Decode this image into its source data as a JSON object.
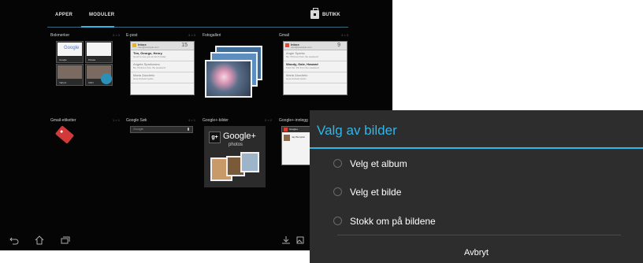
{
  "launcher": {
    "tabs": [
      {
        "label": "APPER"
      },
      {
        "label": "MODULER"
      }
    ],
    "store_label": "BUTIKK",
    "widgets": [
      {
        "label": "Bokmerker",
        "size": "3 × 3"
      },
      {
        "label": "E-post",
        "size": "3 × 3"
      },
      {
        "label": "Fotogalleri",
        "size": ""
      },
      {
        "label": "Gmail",
        "size": "3 × 3"
      },
      {
        "label": "Gmail-etiketter",
        "size": "1 × 1"
      },
      {
        "label": "Google Søk",
        "size": "4 × 1"
      },
      {
        "label": "Google+-bilder",
        "size": "2 × 2"
      },
      {
        "label": "Google+-innlegg",
        "size": "3 × 2"
      }
    ],
    "bookmarks": {
      "google_text": "Google",
      "captions": [
        "Google",
        "Picasa",
        "Yahoo!",
        "CNN"
      ]
    },
    "email": {
      "title": "Inbox",
      "subtitle": "user@example.com",
      "count": "15",
      "items": [
        {
          "name": "Tim, George, Henry",
          "preview": "Good to see you at lunch today"
        },
        {
          "name": "Angela Sparkowna",
          "preview": "Re: Pictures from the weekend"
        },
        {
          "name": "Maria Zacchelo",
          "preview": "How Android works"
        }
      ]
    },
    "gmail": {
      "title": "Inbox",
      "subtitle": "user@example.com",
      "count": "9",
      "items": [
        {
          "name": "Angie Sparks",
          "preview": "Re: Pictures from the weekend"
        },
        {
          "name": "Woody, Gale, Howard",
          "preview": "Fwd: Re: Pic from the weekend"
        },
        {
          "name": "Maria Zacchelo",
          "preview": "How Android works"
        }
      ]
    },
    "search": {
      "hint": "Google"
    },
    "gplus": {
      "title": "Google+",
      "subtitle": "photos"
    },
    "gpost": {
      "header": "Google+",
      "author": "Jay Bumpkin"
    }
  },
  "dialog": {
    "title": "Valg av bilder",
    "options": [
      {
        "label": "Velg et album"
      },
      {
        "label": "Velg et bilde"
      },
      {
        "label": "Stokk om på bildene"
      }
    ],
    "cancel_label": "Avbryt"
  },
  "colors": {
    "accent": "#33b5e5",
    "dialog_bg": "#2d2d2d",
    "launcher_bg": "#050505"
  },
  "icons": [
    "back-icon",
    "home-icon",
    "recent-apps-icon",
    "store-icon",
    "label-tag-icon",
    "microphone-icon"
  ]
}
